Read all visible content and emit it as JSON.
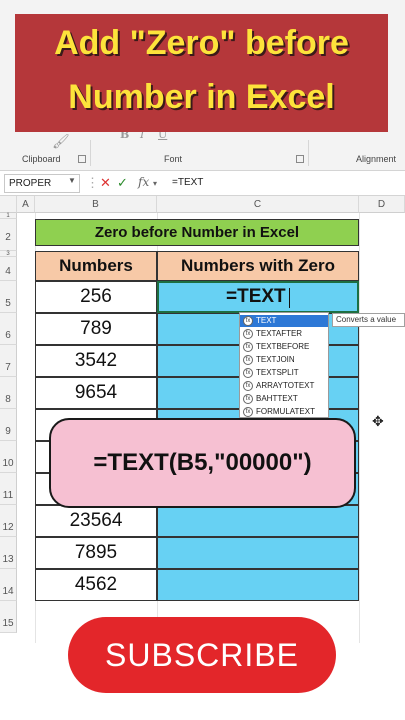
{
  "title": {
    "line1": "Add \"Zero\" before",
    "line2": "Number in Excel"
  },
  "ribbon": {
    "groups": [
      "Clipboard",
      "Font",
      "Alignment"
    ],
    "font_buttons": [
      "B",
      "I",
      "U"
    ]
  },
  "formula_bar": {
    "name_box": "PROPER",
    "cancel_icon": "✕",
    "enter_icon": "✓",
    "fx_label": "fx",
    "content": "=TEXT"
  },
  "columns": [
    "A",
    "B",
    "C",
    "D"
  ],
  "rows": [
    "1",
    "2",
    "3",
    "4",
    "5",
    "6",
    "7",
    "8",
    "9",
    "10",
    "11",
    "12",
    "13",
    "14",
    "15"
  ],
  "sheet": {
    "heading": "Zero before Number in Excel",
    "col_headers": [
      "Numbers",
      "Numbers with Zero"
    ],
    "numbers": [
      "256",
      "789",
      "3542",
      "9654",
      "",
      "",
      "23564",
      "7895",
      "4562"
    ],
    "active_cell_text": "=TEXT"
  },
  "autocomplete": {
    "items": [
      "TEXT",
      "TEXTAFTER",
      "TEXTBEFORE",
      "TEXTJOIN",
      "TEXTSPLIT",
      "ARRAYTOTEXT",
      "BAHTTEXT",
      "FORMULATEXT"
    ],
    "selected_index": 0,
    "tooltip": "Converts a value"
  },
  "callout": {
    "formula": "=TEXT(B5,\"00000\")"
  },
  "subscribe": {
    "label": "SUBSCRIBE",
    "color": "#e3262a"
  },
  "colors": {
    "banner": "#b5373a",
    "banner_text": "#fde33b",
    "heading_green": "#8fd050",
    "header_peach": "#f7c9a7",
    "cell_blue": "#67d1f3",
    "callout_pink": "#f6c0d2"
  }
}
